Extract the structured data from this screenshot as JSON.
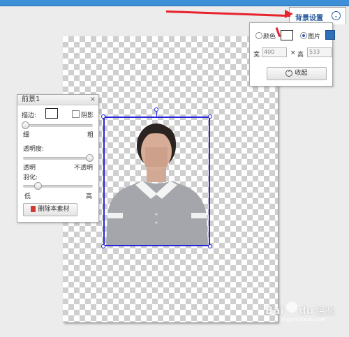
{
  "foreground_panel": {
    "title": "前景1",
    "close_label": "×",
    "stroke_label": "描边:",
    "shadow_label": "阴影",
    "thin_label": "细",
    "thick_label": "粗",
    "opacity_label": "透明度:",
    "transparent_label": "透明",
    "opaque_label": "不透明",
    "feather_label": "羽化:",
    "low_label": "低",
    "high_label": "高",
    "delete_label": "删除本素材",
    "stroke_slider": 0.0,
    "opacity_slider": 1.0,
    "feather_slider": 0.2
  },
  "background_panel": {
    "title": "背景设置",
    "color_label": "颜色",
    "image_label": "图片",
    "width_label": "宽",
    "width_value": "400",
    "times": "×",
    "height_label": "高",
    "height_value": "533",
    "collapse_label": "收起",
    "selected_option": "image"
  },
  "watermark": {
    "text1": "Bai",
    "text2": "du",
    "text3": "经验",
    "sub": "jingyan.baidu.com"
  },
  "colors": {
    "accent": "#2d63c6",
    "selection": "#2626d8",
    "arrow": "#e8232e",
    "topbar": "#3d8fd8"
  }
}
